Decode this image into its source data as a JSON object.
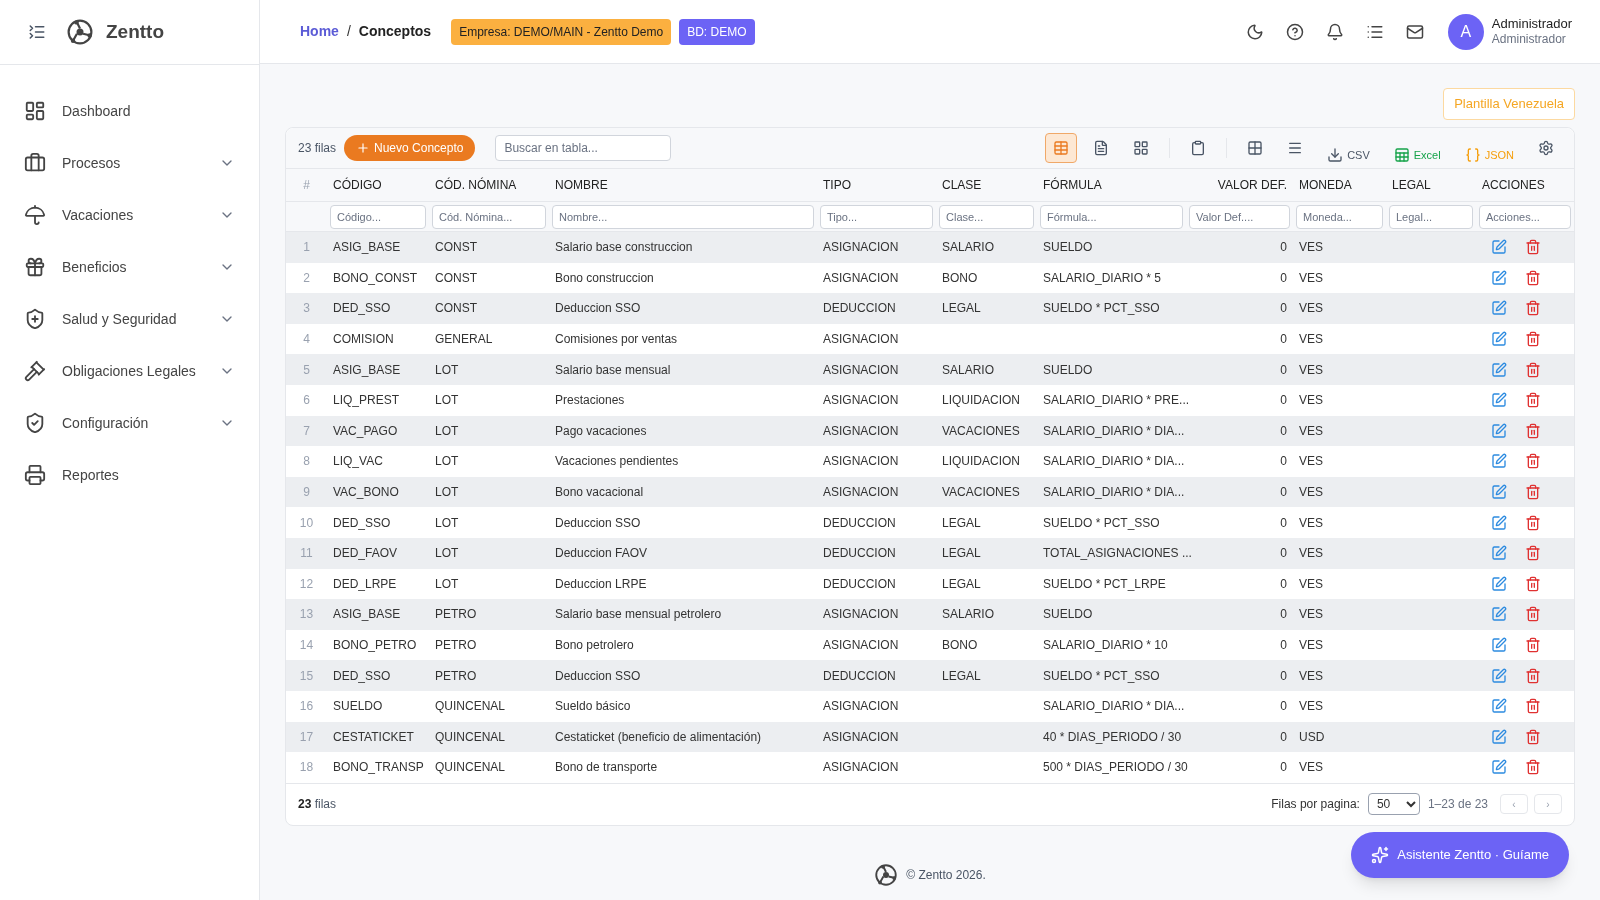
{
  "brand": {
    "name": "Zentto"
  },
  "sidebar": {
    "items": [
      {
        "label": "Dashboard",
        "has_submenu": false
      },
      {
        "label": "Procesos",
        "has_submenu": true
      },
      {
        "label": "Vacaciones",
        "has_submenu": true
      },
      {
        "label": "Beneficios",
        "has_submenu": true
      },
      {
        "label": "Salud y Seguridad",
        "has_submenu": true
      },
      {
        "label": "Obligaciones Legales",
        "has_submenu": true
      },
      {
        "label": "Configuración",
        "has_submenu": true
      },
      {
        "label": "Reportes",
        "has_submenu": false
      }
    ]
  },
  "breadcrumb": [
    "Home",
    "/",
    "Conceptos"
  ],
  "badges": [
    {
      "text": "Empresa: DEMO/MAIN - Zentto Demo",
      "color": "#fbb040"
    },
    {
      "text": "BD: DEMO",
      "color": "#6c63f5"
    }
  ],
  "user": {
    "initial": "A",
    "name": "Administrador",
    "role": "Administrador"
  },
  "template_button": "Plantilla Venezuela",
  "toolbar": {
    "row_count": "23 filas",
    "new_button": "Nuevo Concepto",
    "search_placeholder": "Buscar en tabla...",
    "view_buttons": [
      {
        "selected": true
      },
      {
        "selected": false
      },
      {
        "selected": false
      }
    ],
    "exports": [
      {
        "kind": "csv",
        "label": "CSV"
      },
      {
        "kind": "excel",
        "label": "Excel"
      },
      {
        "kind": "json",
        "label": "JSON"
      }
    ]
  },
  "table": {
    "columns": [
      {
        "label": "#"
      },
      {
        "label": "CÓDIGO",
        "placeholder": "Código..."
      },
      {
        "label": "CÓD. NÓMINA",
        "placeholder": "Cód. Nómina..."
      },
      {
        "label": "NOMBRE",
        "placeholder": "Nombre..."
      },
      {
        "label": "TIPO",
        "placeholder": "Tipo..."
      },
      {
        "label": "CLASE",
        "placeholder": "Clase..."
      },
      {
        "label": "FÓRMULA",
        "placeholder": "Fórmula..."
      },
      {
        "label": "VALOR DEF.",
        "placeholder": "Valor Def...."
      },
      {
        "label": "MONEDA",
        "placeholder": "Moneda..."
      },
      {
        "label": "LEGAL",
        "placeholder": "Legal..."
      },
      {
        "label": "ACCIONES",
        "placeholder": "Acciones..."
      }
    ],
    "rows": [
      {
        "cells": [
          "1",
          "ASIG_BASE",
          "CONST",
          "Salario base construccion",
          "ASIGNACION",
          "SALARIO",
          "SUELDO",
          "0",
          "VES",
          ""
        ]
      },
      {
        "cells": [
          "2",
          "BONO_CONST",
          "CONST",
          "Bono construccion",
          "ASIGNACION",
          "BONO",
          "SALARIO_DIARIO * 5",
          "0",
          "VES",
          ""
        ]
      },
      {
        "cells": [
          "3",
          "DED_SSO",
          "CONST",
          "Deduccion SSO",
          "DEDUCCION",
          "LEGAL",
          "SUELDO * PCT_SSO",
          "0",
          "VES",
          ""
        ]
      },
      {
        "cells": [
          "4",
          "COMISION",
          "GENERAL",
          "Comisiones por ventas",
          "ASIGNACION",
          "",
          "",
          "0",
          "VES",
          ""
        ]
      },
      {
        "cells": [
          "5",
          "ASIG_BASE",
          "LOT",
          "Salario base mensual",
          "ASIGNACION",
          "SALARIO",
          "SUELDO",
          "0",
          "VES",
          ""
        ]
      },
      {
        "cells": [
          "6",
          "LIQ_PREST",
          "LOT",
          "Prestaciones",
          "ASIGNACION",
          "LIQUIDACION",
          "SALARIO_DIARIO * PRE...",
          "0",
          "VES",
          ""
        ]
      },
      {
        "cells": [
          "7",
          "VAC_PAGO",
          "LOT",
          "Pago vacaciones",
          "ASIGNACION",
          "VACACIONES",
          "SALARIO_DIARIO * DIA...",
          "0",
          "VES",
          ""
        ]
      },
      {
        "cells": [
          "8",
          "LIQ_VAC",
          "LOT",
          "Vacaciones pendientes",
          "ASIGNACION",
          "LIQUIDACION",
          "SALARIO_DIARIO * DIA...",
          "0",
          "VES",
          ""
        ]
      },
      {
        "cells": [
          "9",
          "VAC_BONO",
          "LOT",
          "Bono vacacional",
          "ASIGNACION",
          "VACACIONES",
          "SALARIO_DIARIO * DIA...",
          "0",
          "VES",
          ""
        ]
      },
      {
        "cells": [
          "10",
          "DED_SSO",
          "LOT",
          "Deduccion SSO",
          "DEDUCCION",
          "LEGAL",
          "SUELDO * PCT_SSO",
          "0",
          "VES",
          ""
        ]
      },
      {
        "cells": [
          "11",
          "DED_FAOV",
          "LOT",
          "Deduccion FAOV",
          "DEDUCCION",
          "LEGAL",
          "TOTAL_ASIGNACIONES ...",
          "0",
          "VES",
          ""
        ]
      },
      {
        "cells": [
          "12",
          "DED_LRPE",
          "LOT",
          "Deduccion LRPE",
          "DEDUCCION",
          "LEGAL",
          "SUELDO * PCT_LRPE",
          "0",
          "VES",
          ""
        ]
      },
      {
        "cells": [
          "13",
          "ASIG_BASE",
          "PETRO",
          "Salario base mensual petrolero",
          "ASIGNACION",
          "SALARIO",
          "SUELDO",
          "0",
          "VES",
          ""
        ]
      },
      {
        "cells": [
          "14",
          "BONO_PETRO",
          "PETRO",
          "Bono petrolero",
          "ASIGNACION",
          "BONO",
          "SALARIO_DIARIO * 10",
          "0",
          "VES",
          ""
        ]
      },
      {
        "cells": [
          "15",
          "DED_SSO",
          "PETRO",
          "Deduccion SSO",
          "DEDUCCION",
          "LEGAL",
          "SUELDO * PCT_SSO",
          "0",
          "VES",
          ""
        ]
      },
      {
        "cells": [
          "16",
          "SUELDO",
          "QUINCENAL",
          "Sueldo básico",
          "ASIGNACION",
          "",
          "SALARIO_DIARIO * DIA...",
          "0",
          "VES",
          ""
        ]
      },
      {
        "cells": [
          "17",
          "CESTATICKET",
          "QUINCENAL",
          "Cestaticket (beneficio de alimentación)",
          "ASIGNACION",
          "",
          "40 * DIAS_PERIODO / 30",
          "0",
          "USD",
          ""
        ]
      },
      {
        "cells": [
          "18",
          "BONO_TRANSP",
          "QUINCENAL",
          "Bono de transporte",
          "ASIGNACION",
          "",
          "500 * DIAS_PERIODO / 30",
          "0",
          "VES",
          ""
        ]
      }
    ]
  },
  "table_footer": {
    "count": "23",
    "count_label": "filas",
    "per_page_label": "Filas por pagina:",
    "per_page": "50",
    "range": "1–23 de 23",
    "prev": "‹",
    "next": "›"
  },
  "footer": {
    "text": "© Zentto 2026."
  },
  "assistant_button": "Asistente Zentto · Guíame"
}
